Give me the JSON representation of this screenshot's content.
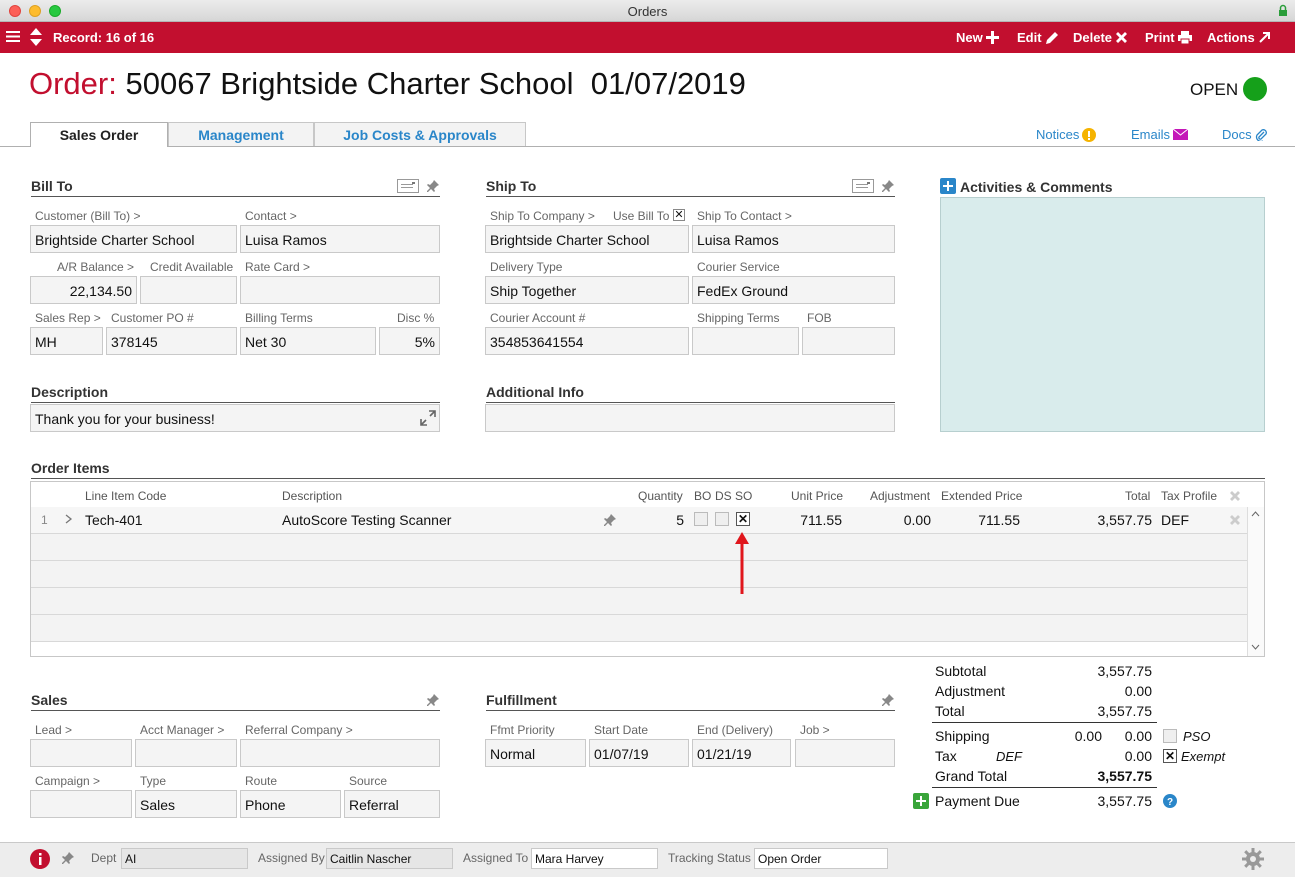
{
  "window": {
    "title": "Orders"
  },
  "toolbar": {
    "record": "Record: 16 of 16",
    "new": "New",
    "edit": "Edit",
    "delete": "Delete",
    "print": "Print",
    "actions": "Actions"
  },
  "header": {
    "order_prefix": "Order:",
    "order_title": "50067 Brightside Charter School  01/07/2019",
    "status": "OPEN",
    "status_color": "#15a01a",
    "brand_color": "#c20f2f"
  },
  "tabs": [
    "Sales Order",
    "Management",
    "Job Costs & Approvals"
  ],
  "toplinks": {
    "notices": "Notices",
    "emails": "Emails",
    "docs": "Docs"
  },
  "bill_to": {
    "title": "Bill To",
    "customer_label": "Customer (Bill To) >",
    "customer": "Brightside Charter School",
    "contact_label": "Contact >",
    "contact": "Luisa Ramos",
    "ar_label": "A/R Balance >",
    "ar": "22,134.50",
    "credit_label": "Credit Available",
    "credit": "",
    "rate_label": "Rate Card >",
    "rate": "",
    "rep_label": "Sales Rep >",
    "rep": "MH",
    "po_label": "Customer PO #",
    "po": "378145",
    "terms_label": "Billing Terms",
    "terms": "Net 30",
    "disc_label": "Disc %",
    "disc": "5%"
  },
  "ship_to": {
    "title": "Ship To",
    "company_label": "Ship To Company >",
    "use_bill_label": "Use Bill To",
    "company": "Brightside Charter School",
    "contact_label": "Ship To Contact >",
    "contact": "Luisa Ramos",
    "delivery_label": "Delivery Type",
    "delivery": "Ship Together",
    "courier_label": "Courier Service",
    "courier": "FedEx Ground",
    "account_label": "Courier Account #",
    "account": "354853641554",
    "shipterms_label": "Shipping Terms",
    "shipterms": "",
    "fob_label": "FOB",
    "fob": ""
  },
  "activities": {
    "title": "Activities & Comments"
  },
  "description": {
    "title": "Description",
    "value": "Thank you for your business!"
  },
  "additional": {
    "title": "Additional Info",
    "value": ""
  },
  "order_items": {
    "title": "Order Items",
    "columns": {
      "code": "Line Item Code",
      "desc": "Description",
      "qty": "Quantity",
      "bo": "BO",
      "ds": "DS",
      "so": "SO",
      "unit": "Unit Price",
      "adj": "Adjustment",
      "ext": "Extended Price",
      "total": "Total",
      "tax": "Tax Profile"
    },
    "rows": [
      {
        "num": "1",
        "code": "Tech-401",
        "desc": "AutoScore Testing Scanner",
        "qty": "5",
        "bo": false,
        "ds": false,
        "so": true,
        "unit": "711.55",
        "adj": "0.00",
        "ext": "711.55",
        "total": "3,557.75",
        "tax": "DEF"
      }
    ]
  },
  "totals": {
    "subtotal_label": "Subtotal",
    "subtotal": "3,557.75",
    "adjustment_label": "Adjustment",
    "adjustment": "0.00",
    "total_label": "Total",
    "total": "3,557.75",
    "shipping_label": "Shipping",
    "shipping_a": "0.00",
    "shipping_b": "0.00",
    "pso_label": "PSO",
    "tax_label": "Tax",
    "tax_profile": "DEF",
    "tax": "0.00",
    "exempt_label": "Exempt",
    "grand_label": "Grand Total",
    "grand": "3,557.75",
    "payment_label": "Payment Due",
    "payment": "3,557.75"
  },
  "sales": {
    "title": "Sales",
    "lead_label": "Lead >",
    "lead": "",
    "acct_label": "Acct Manager >",
    "acct": "",
    "referral_co_label": "Referral Company >",
    "referral_co": "",
    "campaign_label": "Campaign >",
    "campaign": "",
    "type_label": "Type",
    "type": "Sales",
    "route_label": "Route",
    "route": "Phone",
    "source_label": "Source",
    "source": "Referral"
  },
  "fulfillment": {
    "title": "Fulfillment",
    "priority_label": "Ffmt Priority",
    "priority": "Normal",
    "start_label": "Start Date",
    "start": "01/07/19",
    "end_label": "End (Delivery)",
    "end": "01/21/19",
    "job_label": "Job >",
    "job": ""
  },
  "footer": {
    "dept_label": "Dept",
    "dept": "AI",
    "assigned_by_label": "Assigned By",
    "assigned_by": "Caitlin Nascher",
    "assigned_to_label": "Assigned To",
    "assigned_to": "Mara Harvey",
    "tracking_label": "Tracking Status",
    "tracking": "Open Order"
  }
}
